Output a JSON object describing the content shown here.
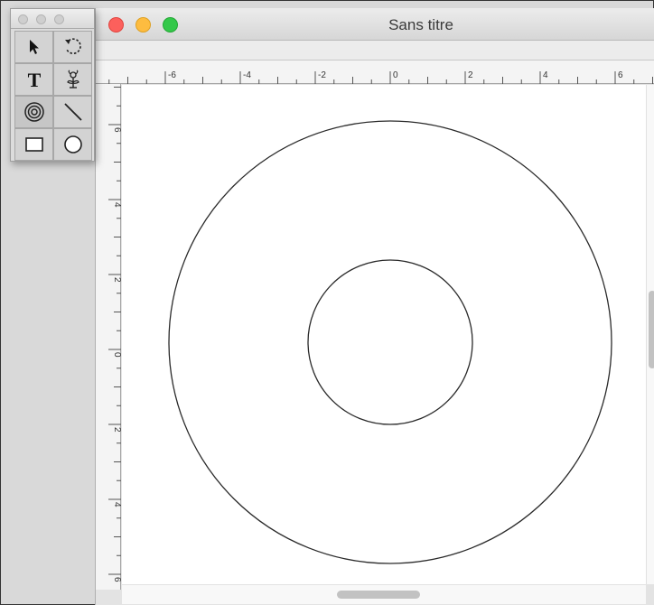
{
  "window": {
    "title": "Sans titre"
  },
  "palette": {
    "tools": [
      {
        "name": "select-tool",
        "icon": "arrow-pointer-icon"
      },
      {
        "name": "rotate-tool",
        "icon": "rotate-icon"
      },
      {
        "name": "text-tool",
        "icon": "text-T-icon",
        "glyph": "T"
      },
      {
        "name": "symbol-tool",
        "icon": "flower-icon"
      },
      {
        "name": "concentric-circles-tool",
        "icon": "target-icon"
      },
      {
        "name": "line-tool",
        "icon": "diagonal-line-icon"
      },
      {
        "name": "rectangle-tool",
        "icon": "rectangle-icon"
      },
      {
        "name": "ellipse-tool",
        "icon": "circle-icon"
      }
    ]
  },
  "ruler": {
    "horizontal_labels": [
      "-6",
      "-4",
      "-2",
      "0",
      "2",
      "4",
      "6"
    ],
    "vertical_labels": [
      "6",
      "4",
      "2",
      "0",
      "2",
      "4",
      "6"
    ]
  },
  "drawing": {
    "shapes": [
      "outer-circle",
      "inner-circle"
    ],
    "stroke_color": "#2a2a2a"
  },
  "colors": {
    "close": "#fc605c",
    "minimize": "#fdbc40",
    "maximize": "#34c84a"
  }
}
